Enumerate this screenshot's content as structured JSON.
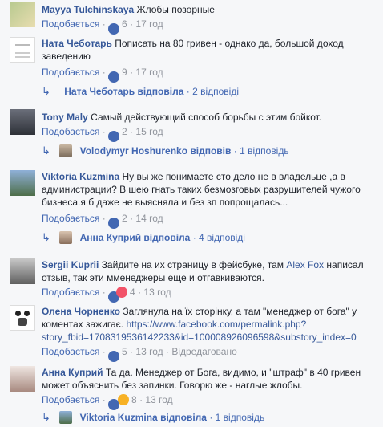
{
  "comments": [
    {
      "author": "Mayya Tulchinskaya",
      "text": "Жлобы позорные",
      "like_label": "Подобається",
      "reactions": "6",
      "time": "17 год"
    },
    {
      "author": "Ната Чеботарь",
      "text_line1": "Пописать на 80 гривен - однако да, большой доход",
      "text_line2": "заведению",
      "like_label": "Подобається",
      "reactions": "9",
      "time": "17 год",
      "reply_summary": "Ната Чеботарь відповіла",
      "reply_count": "2 відповіді"
    },
    {
      "author": "Tony Maly",
      "text": "Самый действующий способ борьбы с этим бойкот.",
      "like_label": "Подобається",
      "reactions": "2",
      "time": "15 год",
      "reply_summary": "Volodymyr Hoshurenko відповів",
      "reply_count": "1 відповідь"
    },
    {
      "author": "Viktoria Kuzmina",
      "text_line1": "Ну вы же понимаете сто дело не в владельце ,а в",
      "text_line2": "администрации? В шею гнать таких безмозговых разрушителей чужого",
      "text_line3": "бизнеса.я б даже не выясняла и без зп попрощалась...",
      "like_label": "Подобається",
      "reactions": "2",
      "time": "14 год",
      "reply_summary": "Анна Куприй відповіла",
      "reply_count": "4 відповіді"
    },
    {
      "author": "Sergii Kuprii",
      "text_part1": "Зайдите на их страницу в фейсбуке, там",
      "mention": "Alex Fox",
      "text_part2": "написал",
      "text_line2": "отзыв, так эти мменеджеры еще и отгавкиваются.",
      "like_label": "Подобається",
      "reactions": "4",
      "time": "13 год"
    },
    {
      "author": "Олена Чорненко",
      "text_line1": "Заглянула на їх сторінку, а там \"менеджер от бога\" у",
      "text_line2": "коментах зажигає.",
      "link_line1": "https://www.facebook.com/permalink.php?",
      "link_line2": "story_fbid=1708319536142233&id=100008926096598&substory_index=0",
      "like_label": "Подобається",
      "reactions": "5",
      "time": "13 год",
      "edited": "Відредаговано"
    },
    {
      "author": "Анна Куприй",
      "text_line1": "Та да. Менеджер от Бога, видимо, и \"штраф\" в 40 гривен",
      "text_line2": "может объяснить без запинки. Говорю же - наглые жлобы.",
      "like_label": "Подобається",
      "reactions": "8",
      "time": "13 год",
      "reply_summary": "Viktoria Kuzmina відповіла",
      "reply_count": "1 відповідь"
    }
  ],
  "separator": "·",
  "colors": {
    "link": "#365899",
    "like": "#4267b2",
    "meta": "#90949c",
    "bg": "#f6f7f9"
  }
}
